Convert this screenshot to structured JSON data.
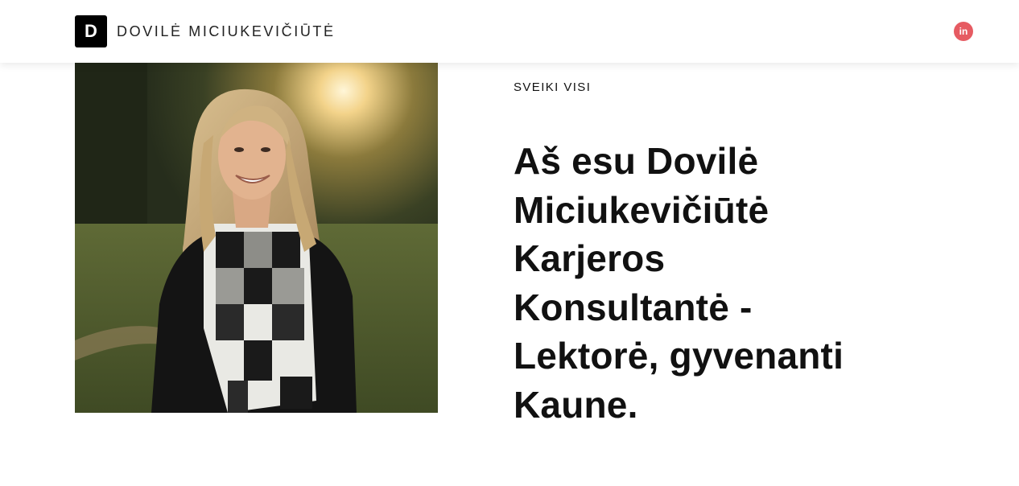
{
  "header": {
    "logo_letter": "D",
    "site_name": "DOVILĖ MICIUKEVIČIŪTĖ",
    "social_icon_text": "in",
    "accent_color": "#e65b62"
  },
  "hero": {
    "eyebrow": "SVEIKI VISI",
    "headline_lines": [
      "Aš esu Dovilė",
      "Miciukevičiūtė",
      "Karjeros",
      "Konsultantė -",
      "Lektorė, gyvenanti",
      "Kaune."
    ],
    "photo_icon": "portrait-photo"
  }
}
